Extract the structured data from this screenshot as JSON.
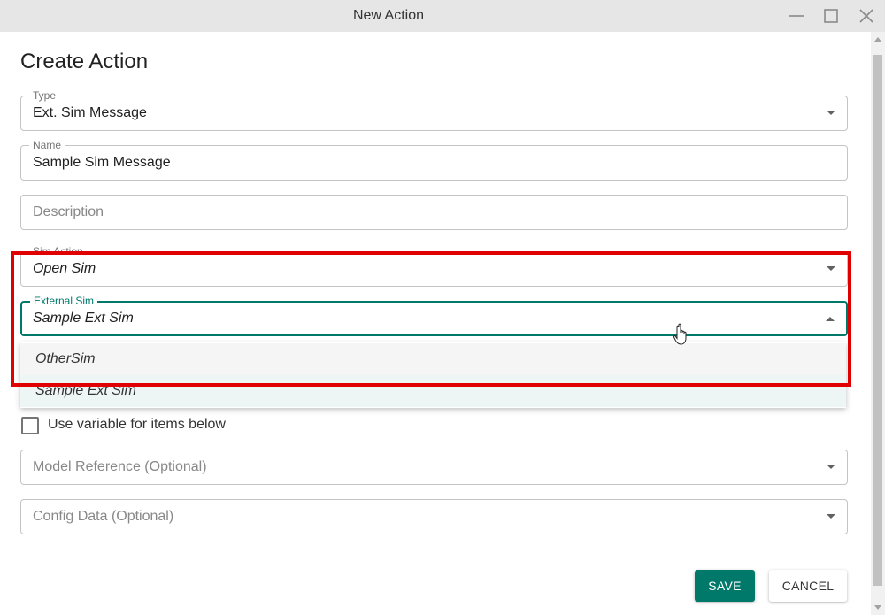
{
  "window": {
    "title": "New Action"
  },
  "form": {
    "heading": "Create Action",
    "type": {
      "label": "Type",
      "value": "Ext. Sim Message"
    },
    "name": {
      "label": "Name",
      "value": "Sample Sim Message"
    },
    "description": {
      "placeholder": "Description"
    },
    "sim_action": {
      "label": "Sim Action",
      "value": "Open Sim"
    },
    "external_sim": {
      "label": "External Sim",
      "value": "Sample Ext Sim",
      "options": [
        "OtherSim",
        "Sample Ext Sim"
      ]
    },
    "use_variable": {
      "label": "Use variable for items below",
      "checked": false
    },
    "model_reference": {
      "placeholder": "Model Reference (Optional)"
    },
    "config_data": {
      "placeholder": "Config Data (Optional)"
    }
  },
  "actions": {
    "save_label": "SAVE",
    "cancel_label": "CANCEL"
  },
  "colors": {
    "accent": "#00796b",
    "highlight": "#e00000",
    "titlebar": "#e6e6e6"
  }
}
